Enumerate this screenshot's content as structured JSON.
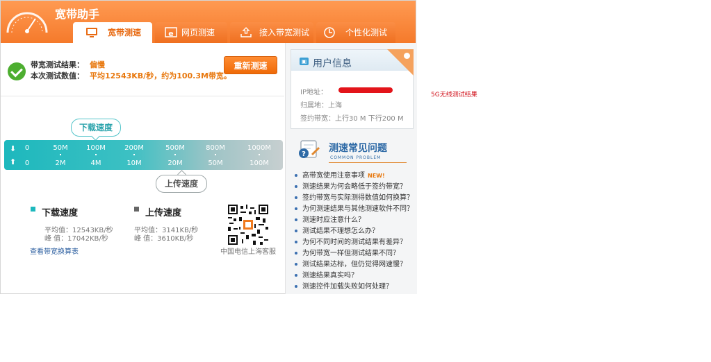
{
  "app": {
    "title": "宽带助手"
  },
  "tabs": [
    {
      "label": "宽带测速",
      "icon": "monitor-icon",
      "active": true
    },
    {
      "label": "网页测速",
      "icon": "ie-browser-icon",
      "active": false
    },
    {
      "label": "接入带宽测试",
      "icon": "upload-tray-icon",
      "active": false
    },
    {
      "label": "个性化测试",
      "icon": "clock-icon",
      "active": false
    }
  ],
  "result": {
    "result_label": "带宽测试结果：",
    "result_value": "偏慢",
    "value_label": "本次测试数值：",
    "value_text": "平均12543KB/秒，约为100.3M带宽。",
    "retest_button": "重新测速"
  },
  "speed_bar": {
    "download_bubble": "下载速度",
    "upload_bubble": "上传速度",
    "download_ticks": [
      "0",
      "50M",
      "100M",
      "200M",
      "500M",
      "800M",
      "1000M"
    ],
    "upload_ticks": [
      "0",
      "2M",
      "4M",
      "10M",
      "20M",
      "50M",
      "100M"
    ]
  },
  "stats": {
    "download": {
      "title": "下载速度",
      "avg": "平均值：12543KB/秒",
      "peak": "峰  值：17042KB/秒",
      "color": "#1db8bd"
    },
    "upload": {
      "title": "上传速度",
      "avg": "平均值：3141KB/秒",
      "peak": "峰  值：3610KB/秒",
      "color": "#666666"
    },
    "conversion_link": "查看带宽换算表",
    "qr_label": "中国电信上海客服"
  },
  "user_info": {
    "title": "用户信息",
    "ip_label": "IP地址：",
    "region": "归属地：上海",
    "bandwidth": "签约带宽：上行30 M 下行200 M"
  },
  "faq": {
    "title": "测速常见问题",
    "subtitle": "COMMON PROBLEM",
    "new_badge": "NEW!",
    "items": [
      "高带宽使用注意事项",
      "测速结果为何会略低于签约带宽？",
      "签约带宽与实际测得数值如何换算？",
      "为何测速结果与其他测速软件不同？",
      "测速时应注意什么？",
      "测试结果不理想怎么办？",
      "为何不同时间的测试结果有差异？",
      "为何带宽一样但测试结果不同？",
      "测试结果达标，但仍觉得网速慢？",
      "测速结果真实吗？",
      "测速控件加载失败如何处理？"
    ]
  },
  "annotation": "5G无线测试结果",
  "colors": {
    "accent": "#f57a2b",
    "teal": "#1db8bd",
    "link": "#2a5d9f",
    "result": "#e8780e"
  }
}
